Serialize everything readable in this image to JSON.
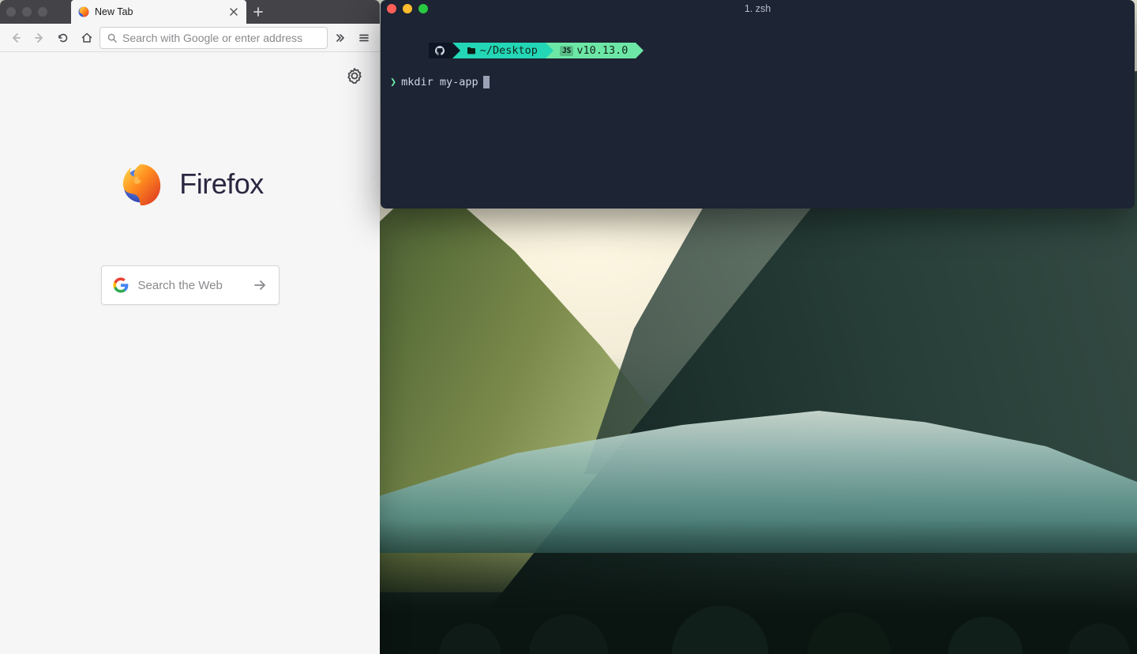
{
  "firefox": {
    "tab_title": "New Tab",
    "url_placeholder": "Search with Google or enter address",
    "brand_name": "Firefox",
    "search_placeholder": "Search the Web"
  },
  "terminal": {
    "title": "1. zsh",
    "prompt_path": "~/Desktop",
    "prompt_node_tag": "JS",
    "prompt_node_version": "v10.13.0",
    "cmd_prompt": "❯",
    "command": "mkdir my-app"
  }
}
